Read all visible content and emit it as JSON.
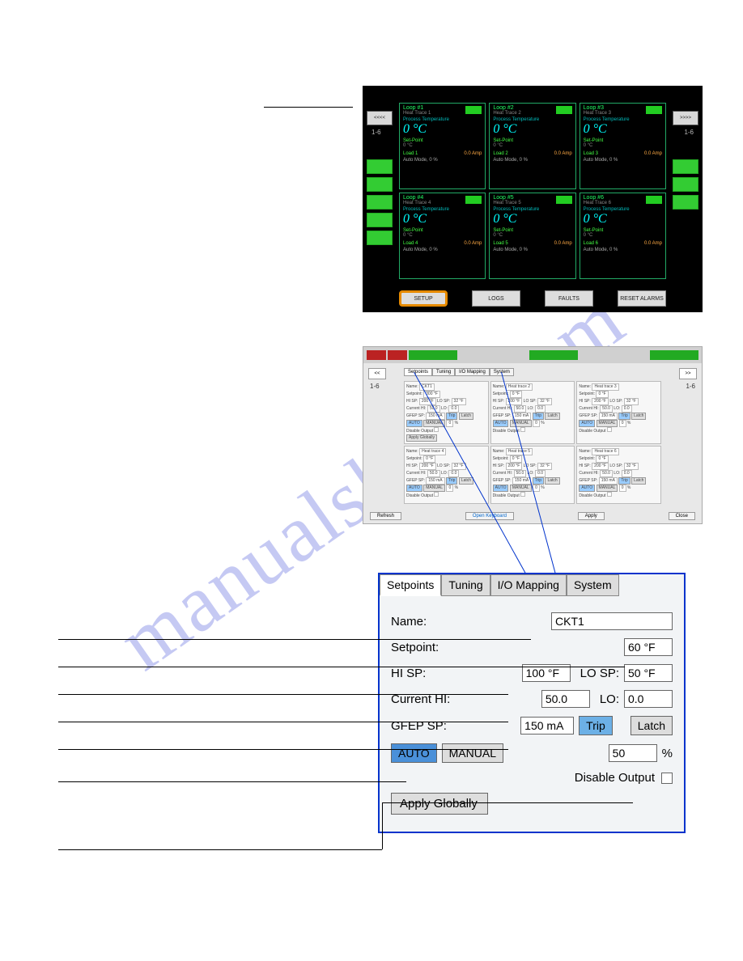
{
  "watermark": "manualshive.com",
  "fig1": {
    "nav_prev": "<<<<",
    "nav_next": ">>>>",
    "page_range": "1-6",
    "loops": [
      {
        "title": "Loop #1",
        "sub": "Heat Trace 1",
        "proc": "Process Temperature",
        "temp": "0 °C",
        "sp_lbl": "Set-Point",
        "sp_val": "0 °C",
        "load": "Load 1",
        "amp": "0.0 Amp",
        "mode": "Auto Mode, 0  %"
      },
      {
        "title": "Loop #2",
        "sub": "Heat Trace 2",
        "proc": "Process Temperature",
        "temp": "0 °C",
        "sp_lbl": "Set-Point",
        "sp_val": "0 °C",
        "load": "Load 2",
        "amp": "0.0 Amp",
        "mode": "Auto Mode, 0  %"
      },
      {
        "title": "Loop #3",
        "sub": "Heat Trace 3",
        "proc": "Process Temperature",
        "temp": "0 °C",
        "sp_lbl": "Set-Point",
        "sp_val": "0 °C",
        "load": "Load 3",
        "amp": "0.0 Amp",
        "mode": "Auto Mode, 0  %"
      },
      {
        "title": "Loop #4",
        "sub": "Heat Trace 4",
        "proc": "Process Temperature",
        "temp": "0 °C",
        "sp_lbl": "Set-Point",
        "sp_val": "0 °C",
        "load": "Load 4",
        "amp": "0.0 Amp",
        "mode": "Auto Mode, 0  %"
      },
      {
        "title": "Loop #5",
        "sub": "Heat Trace 5",
        "proc": "Process Temperature",
        "temp": "0 °C",
        "sp_lbl": "Set-Point",
        "sp_val": "0 °C",
        "load": "Load 5",
        "amp": "0.0 Amp",
        "mode": "Auto Mode, 0  %"
      },
      {
        "title": "Loop #6",
        "sub": "Heat Trace 6",
        "proc": "Process Temperature",
        "temp": "0 °C",
        "sp_lbl": "Set-Point",
        "sp_val": "0 °C",
        "load": "Load 6",
        "amp": "0.0 Amp",
        "mode": "Auto Mode, 0  %"
      }
    ],
    "bottom": {
      "setup": "SETUP",
      "logs": "LOGS",
      "faults": "FAULTS",
      "reset": "RESET ALARMS"
    }
  },
  "fig2": {
    "nav_prev": "<<",
    "nav_next": ">>",
    "page_range": "1-6",
    "tabs": [
      "Setpoints",
      "Tuning",
      "I/O Mapping",
      "System"
    ],
    "mini_common": {
      "name_lbl": "Name:",
      "sp_lbl": "Setpoint:",
      "hi_lbl": "HI SP:",
      "hi_v": "200 °F",
      "lo_lbl": "LO SP:",
      "lo_v": "32 °F",
      "chi_lbl": "Current HI:",
      "chi_v": "50.0",
      "clo_lbl": "LO:",
      "clo_v": "0.0",
      "gf_lbl": "GFEP SP:",
      "gf_v": "150 mA",
      "trip": "Trip",
      "latch": "Latch",
      "auto": "AUTO",
      "manual": "MANUAL",
      "pct": "0",
      "pct_u": "%",
      "dis": "Disable Output",
      "apply": "Apply Globally"
    },
    "minis": [
      {
        "name": "CKT1",
        "sp": "300 °F",
        "apply_g": true
      },
      {
        "name": "Heat trace 2",
        "sp": "0 °F",
        "apply_g": false
      },
      {
        "name": "Heat trace 3",
        "sp": "0 °F",
        "apply_g": false
      },
      {
        "name": "Heat trace 4",
        "sp": "0 °F",
        "apply_g": false
      },
      {
        "name": "Heat trace 5",
        "sp": "0 °F",
        "apply_g": false
      },
      {
        "name": "Heat trace 6",
        "sp": "0 °F",
        "apply_g": false
      }
    ],
    "bottom": {
      "refresh": "Refresh",
      "kbd": "Open Keyboard",
      "apply": "Apply",
      "close": "Close"
    }
  },
  "fig3": {
    "tabs": [
      "Setpoints",
      "Tuning",
      "I/O Mapping",
      "System"
    ],
    "rows": {
      "name_lbl": "Name:",
      "name_val": "CKT1",
      "sp_lbl": "Setpoint:",
      "sp_val": "60 °F",
      "hi_lbl": "HI SP:",
      "hi_val": "100 °F",
      "lo_lbl": "LO SP:",
      "lo_val": "50 °F",
      "chi_lbl": "Current HI:",
      "chi_val": "50.0",
      "clo_lbl": "LO:",
      "clo_val": "0.0",
      "gf_lbl": "GFEP SP:",
      "gf_val": "150 mA",
      "trip": "Trip",
      "latch": "Latch",
      "auto": "AUTO",
      "manual": "MANUAL",
      "pct_val": "50",
      "pct_u": "%",
      "dis_lbl": "Disable Output",
      "apply_g": "Apply Globally"
    }
  }
}
